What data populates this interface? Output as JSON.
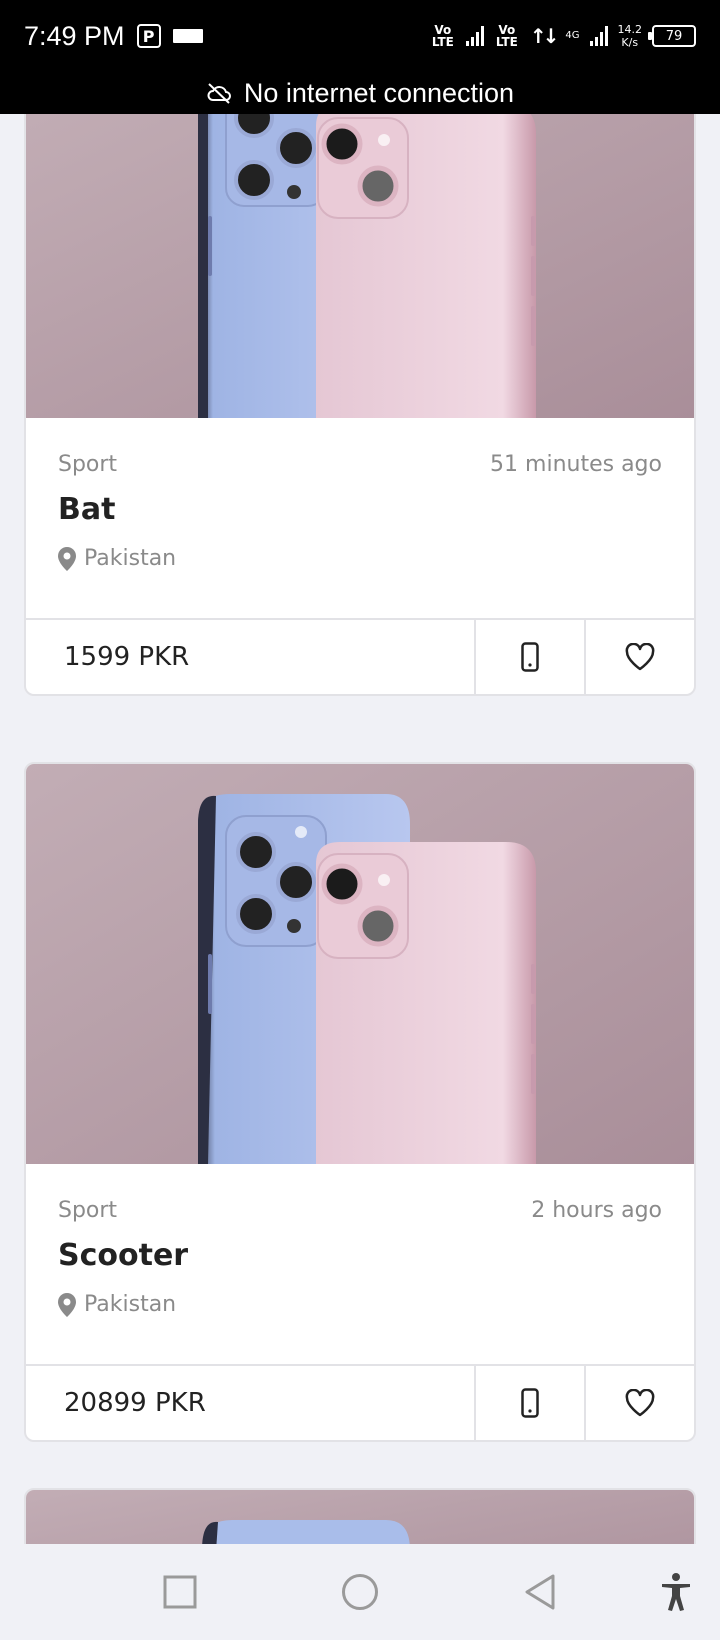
{
  "status_bar": {
    "time": "7:49 PM",
    "volte_1": "Vo LTE",
    "volte_2": "Vo LTE",
    "network_type": "4G",
    "speed_value": "14.2",
    "speed_unit": "K/s",
    "battery": "79"
  },
  "banner": {
    "icon": "cloud-off-icon",
    "text": "No internet connection"
  },
  "listings": [
    {
      "category": "Sport",
      "posted": "51 minutes ago",
      "title": "Bat",
      "location": "Pakistan",
      "price": "1599 PKR"
    },
    {
      "category": "Sport",
      "posted": "2 hours ago",
      "title": "Scooter",
      "location": "Pakistan",
      "price": "20899 PKR"
    }
  ],
  "icons": {
    "location": "map-pin-icon",
    "call": "phone-icon",
    "favorite": "heart-icon",
    "nav_recents": "square-icon",
    "nav_home": "circle-icon",
    "nav_back": "triangle-back-icon",
    "accessibility": "accessibility-icon"
  },
  "colors": {
    "photo_background": "#b9a1aa",
    "text_muted": "#8a8a8a",
    "text_primary": "#222222"
  }
}
